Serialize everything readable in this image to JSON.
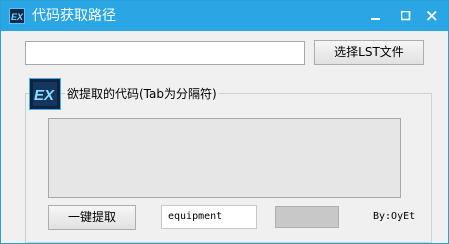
{
  "window": {
    "title": "代码获取路径",
    "accent_color": "#2aa6e4"
  },
  "icons": {
    "app": "ex-logo-icon",
    "minimize": "minimize-icon",
    "maximize": "maximize-icon",
    "close": "close-icon"
  },
  "path": {
    "value": ""
  },
  "select_button": {
    "label": "选择LST文件"
  },
  "group": {
    "label": "欲提取的代码(Tab为分隔符)"
  },
  "code_area": {
    "value": ""
  },
  "extract_button": {
    "label": "一键提取"
  },
  "keyword": {
    "value": "equipment"
  },
  "author": "By:OyEt"
}
